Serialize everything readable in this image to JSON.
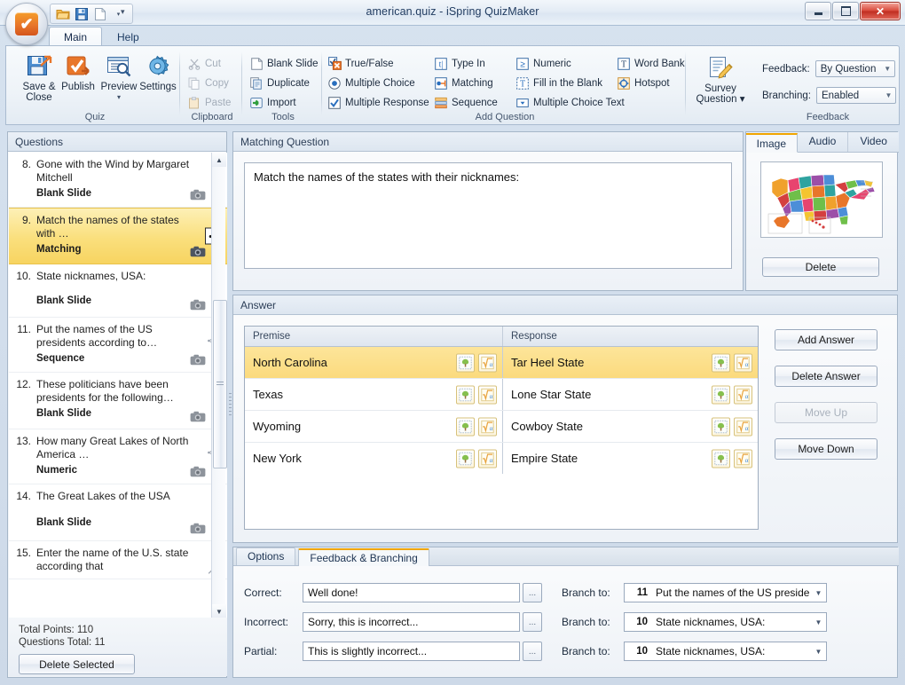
{
  "window": {
    "title": "american.quiz - iSpring QuizMaker",
    "minimize_label": "Minimize",
    "maximize_label": "Maximize",
    "close_label": "✕"
  },
  "quick_access": {
    "open_label": "Open",
    "save_label": "Save",
    "new_label": "New",
    "more_label": "▾",
    "customize_label": "▾"
  },
  "ribbon": {
    "tabs": [
      {
        "label": "Main",
        "active": true
      },
      {
        "label": "Help",
        "active": false
      }
    ],
    "groups": {
      "quiz": {
        "label": "Quiz",
        "buttons": [
          {
            "label": "Save &\nClose",
            "line1": "Save &",
            "line2": "Close"
          },
          {
            "label": "Publish",
            "line1": "Publish",
            "line2": ""
          },
          {
            "label": "Preview",
            "line1": "Preview",
            "line2": "▾"
          },
          {
            "label": "Settings",
            "line1": "Settings",
            "line2": ""
          }
        ]
      },
      "clipboard": {
        "label": "Clipboard",
        "items": [
          {
            "label": "Cut",
            "disabled": true
          },
          {
            "label": "Copy",
            "disabled": true
          },
          {
            "label": "Paste",
            "disabled": true
          }
        ]
      },
      "tools": {
        "label": "Tools",
        "items": [
          {
            "label": "Blank Slide"
          },
          {
            "label": "Duplicate"
          },
          {
            "label": "Import"
          }
        ]
      },
      "add_question": {
        "label": "Add Question",
        "col1": [
          {
            "label": "True/False"
          },
          {
            "label": "Multiple Choice"
          },
          {
            "label": "Multiple Response"
          }
        ],
        "col2": [
          {
            "label": "Type In"
          },
          {
            "label": "Matching"
          },
          {
            "label": "Sequence"
          }
        ],
        "col3": [
          {
            "label": "Numeric"
          },
          {
            "label": "Fill in the Blank"
          },
          {
            "label": "Multiple Choice Text"
          }
        ],
        "col4": [
          {
            "label": "Word Bank"
          },
          {
            "label": "Hotspot"
          }
        ],
        "survey": {
          "line1": "Survey",
          "line2": "Question ▾"
        }
      },
      "feedback": {
        "label": "Feedback",
        "feedback_label": "Feedback:",
        "feedback_value": "By Question",
        "branching_label": "Branching:",
        "branching_value": "Enabled"
      }
    }
  },
  "questions_panel": {
    "header": "Questions",
    "items": [
      {
        "num": "8.",
        "text": "Gone with the Wind by Margaret Mitchell",
        "type": "Blank Slide",
        "selected": false,
        "has_branch": false
      },
      {
        "num": "9.",
        "text": "Match the names of the states with …",
        "type": "Matching",
        "selected": true,
        "has_branch": true
      },
      {
        "num": "10.",
        "text": "State nicknames, USA:",
        "type": "Blank Slide",
        "selected": false,
        "has_branch": false
      },
      {
        "num": "11.",
        "text": "Put the names of the US presidents according to…",
        "type": "Sequence",
        "selected": false,
        "has_branch": true
      },
      {
        "num": "12.",
        "text": "These politicians have been presidents for the following…",
        "type": "Blank Slide",
        "selected": false,
        "has_branch": false
      },
      {
        "num": "13.",
        "text": "How many Great Lakes of North America …",
        "type": "Numeric",
        "selected": false,
        "has_branch": true
      },
      {
        "num": "14.",
        "text": "The Great Lakes of the USA",
        "type": "Blank Slide",
        "selected": false,
        "has_branch": false
      },
      {
        "num": "15.",
        "text": "Enter the name of the U.S. state according that",
        "type": "",
        "selected": false,
        "has_branch": true
      }
    ],
    "total_points": "Total Points: 110",
    "questions_total": "Questions Total: 11",
    "delete_selected_label": "Delete Selected"
  },
  "question_editor": {
    "header": "Matching Question",
    "text": "Match the names of the states with their nicknames:"
  },
  "media_panel": {
    "tabs": [
      {
        "label": "Image",
        "active": true
      },
      {
        "label": "Audio",
        "active": false
      },
      {
        "label": "Video",
        "active": false
      }
    ],
    "delete_label": "Delete",
    "image_alt": "us-states-map"
  },
  "answer_panel": {
    "header": "Answer",
    "columns": [
      "Premise",
      "Response"
    ],
    "rows": [
      {
        "premise": "North Carolina",
        "response": "Tar Heel State",
        "selected": true
      },
      {
        "premise": "Texas",
        "response": "Lone Star State",
        "selected": false
      },
      {
        "premise": "Wyoming",
        "response": "Cowboy State",
        "selected": false
      },
      {
        "premise": "New York",
        "response": "Empire State",
        "selected": false
      }
    ],
    "buttons": [
      {
        "label": "Add Answer",
        "disabled": false
      },
      {
        "label": "Delete Answer",
        "disabled": false
      },
      {
        "label": "Move Up",
        "disabled": true
      },
      {
        "label": "Move Down",
        "disabled": false
      }
    ]
  },
  "bottom_panel": {
    "tabs": [
      {
        "label": "Options",
        "active": false
      },
      {
        "label": "Feedback & Branching",
        "active": true
      }
    ],
    "rows": [
      {
        "label": "Correct:",
        "value": "Well done!",
        "dots": "...",
        "branch_label": "Branch to:",
        "branch_num": "11",
        "branch_text": "Put the names of the US preside"
      },
      {
        "label": "Incorrect:",
        "value": "Sorry, this is incorrect...",
        "dots": "...",
        "branch_label": "Branch to:",
        "branch_num": "10",
        "branch_text": "State nicknames, USA:"
      },
      {
        "label": "Partial:",
        "value": "This is slightly incorrect...",
        "dots": "...",
        "branch_label": "Branch to:",
        "branch_num": "10",
        "branch_text": "State nicknames, USA:"
      }
    ]
  },
  "colors": {
    "accent_orange": "#f0a500",
    "selection_yellow": "#fadf7c",
    "panel_border": "#a6b6c8",
    "close_red": "#c02d20"
  }
}
